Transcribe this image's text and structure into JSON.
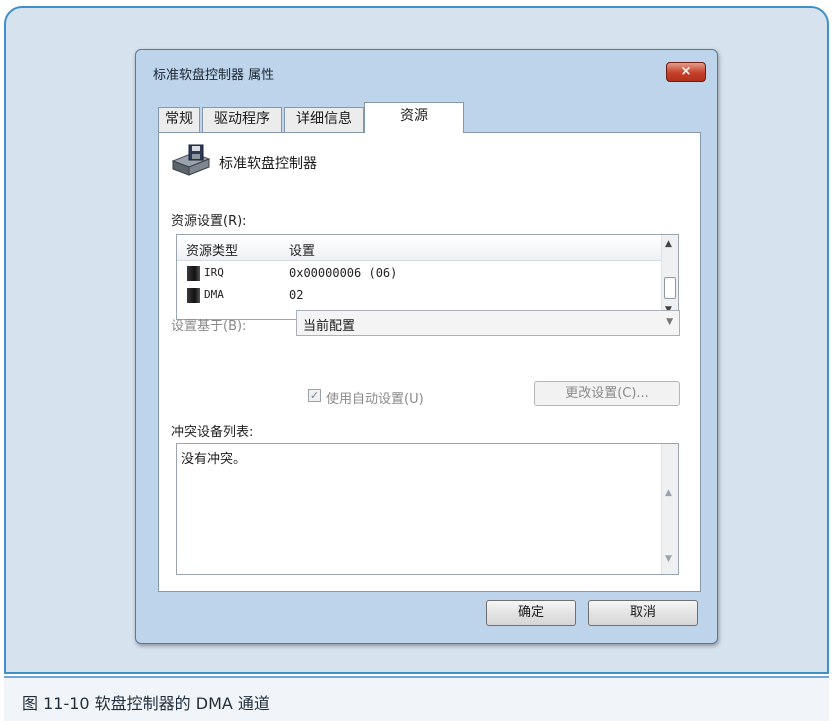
{
  "dialog": {
    "title": "标准软盘控制器 属性",
    "close_label": "×"
  },
  "tabs": [
    {
      "label": "常规",
      "active": false
    },
    {
      "label": "驱动程序",
      "active": false
    },
    {
      "label": "详细信息",
      "active": false
    },
    {
      "label": "资源",
      "active": true
    }
  ],
  "device": {
    "name": "标准软盘控制器",
    "icon": "floppy-controller-icon"
  },
  "resources": {
    "section_label": "资源设置(R):",
    "columns": [
      "资源类型",
      "设置"
    ],
    "rows": [
      {
        "type": "IRQ",
        "setting": "0x00000006 (06)"
      },
      {
        "type": "DMA",
        "setting": "02"
      }
    ]
  },
  "setting_based_on": {
    "label": "设置基于(B):",
    "value": "当前配置"
  },
  "auto_settings": {
    "label": "使用自动设置(U)",
    "checked": true,
    "change_button": "更改设置(C)..."
  },
  "conflicts": {
    "label": "冲突设备列表:",
    "text": "没有冲突。"
  },
  "footer": {
    "ok_label": "确定",
    "cancel_label": "取消"
  },
  "caption": "图 11-10    软盘控制器的 DMA 通道",
  "colors": {
    "frame_border": "#3f90c8",
    "frame_background": "#d6e2ee",
    "dialog_frame": "#bdd4ea",
    "close_button": "#c4402a"
  }
}
